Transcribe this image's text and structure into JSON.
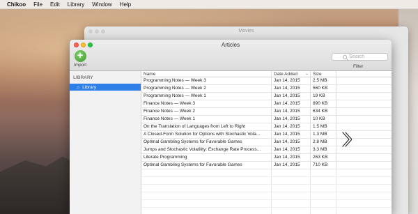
{
  "menubar": {
    "app_name": "Chikoo",
    "items": [
      "File",
      "Edit",
      "Library",
      "Window",
      "Help"
    ]
  },
  "background_window": {
    "title": "Movies"
  },
  "window": {
    "title": "Articles",
    "import_label": "Import",
    "search_placeholder": "Search",
    "filter_label": "Filter"
  },
  "sidebar": {
    "header": "LIBRARY",
    "items": [
      {
        "label": "Library",
        "icon": "house-icon",
        "selected": true
      }
    ]
  },
  "table": {
    "columns": {
      "name": "Name",
      "date": "Date Added",
      "size": "Size"
    },
    "sort_column": "Date Added",
    "rows": [
      {
        "name": "Programming Notes — Week 3",
        "date": "Jan 14, 2015",
        "size": "2.5 MB"
      },
      {
        "name": "Programming Notes — Week 2",
        "date": "Jan 14, 2015",
        "size": "560 KB"
      },
      {
        "name": "Programming Notes — Week 1",
        "date": "Jan 14, 2015",
        "size": "19 KB"
      },
      {
        "name": "Finance Notes — Week 3",
        "date": "Jan 14, 2015",
        "size": "890 KB"
      },
      {
        "name": "Finance Notes — Week 2",
        "date": "Jan 14, 2015",
        "size": "634 KB"
      },
      {
        "name": "Finance Notes — Week 1",
        "date": "Jan 14, 2015",
        "size": "10 KB"
      },
      {
        "name": "On the Translation of Languages from Left to Right",
        "date": "Jan 14, 2015",
        "size": "1.5 MB"
      },
      {
        "name": "A Closed-Form Solution for Options with Stochastic Vola...",
        "date": "Jan 14, 2015",
        "size": "1.3 MB"
      },
      {
        "name": "Optimal Gambling Systems for Favorable Games",
        "date": "Jan 14, 2015",
        "size": "2.8 MB"
      },
      {
        "name": "Jumps and Stochastic Volatility: Exchange Rate Process...",
        "date": "Jan 14, 2015",
        "size": "3.3 MB"
      },
      {
        "name": "Literate Programming",
        "date": "Jan 14, 2015",
        "size": "263 KB"
      },
      {
        "name": "Optimal Gambling Systems for Favorable Games",
        "date": "Jan 14, 2015",
        "size": "710 KB"
      }
    ]
  },
  "colors": {
    "selection": "#2f7fe8",
    "close": "#fc5f57",
    "minimize": "#fdbc2e",
    "maximize": "#29c740",
    "import_green": "#3f9a2e"
  },
  "icons": [
    "plus-icon",
    "search-icon",
    "house-icon",
    "chevron-right-icon",
    "sort-descending-icon"
  ]
}
